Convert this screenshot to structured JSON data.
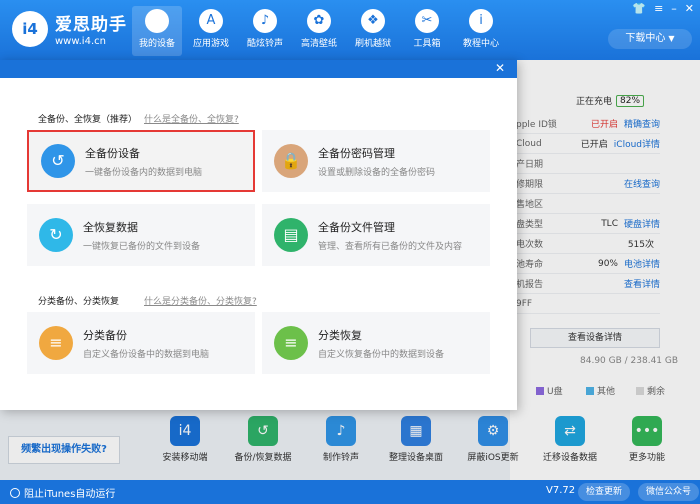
{
  "app": {
    "name": "爱思助手",
    "url": "www.i4.cn",
    "logo_text": "i4"
  },
  "nav": [
    {
      "label": "我的设备",
      "icon": "apple-icon",
      "glyph": "",
      "active": true
    },
    {
      "label": "应用游戏",
      "icon": "app-store-icon",
      "glyph": "A"
    },
    {
      "label": "酷炫铃声",
      "icon": "bell-icon",
      "glyph": "♪"
    },
    {
      "label": "高清壁纸",
      "icon": "flower-icon",
      "glyph": "✿"
    },
    {
      "label": "刷机越狱",
      "icon": "box-icon",
      "glyph": "❖"
    },
    {
      "label": "工具箱",
      "icon": "tools-icon",
      "glyph": "✂"
    },
    {
      "label": "教程中心",
      "icon": "info-icon",
      "glyph": "i"
    }
  ],
  "download_center": "下载中心",
  "device_info": {
    "charging": "正在充电",
    "battery": "82%",
    "rows": [
      {
        "label": "pple ID锁",
        "value": "已开启",
        "link": "精确查询"
      },
      {
        "label": "Cloud",
        "value": "已开启",
        "link": "iCloud详情"
      },
      {
        "label": "产日期",
        "value": "",
        "link": ""
      },
      {
        "label": "修期限",
        "value": "",
        "link": "在线查询"
      },
      {
        "label": "售地区",
        "value": "",
        "link": ""
      },
      {
        "label": "盘类型",
        "value": "TLC",
        "link": "硬盘详情"
      },
      {
        "label": "电次数",
        "value": "515次",
        "link": ""
      },
      {
        "label": "池寿命",
        "value": "90%",
        "link": "电池详情"
      },
      {
        "label": "机报告",
        "value": "",
        "link": "查看详情"
      },
      {
        "label": "9FF",
        "value": "",
        "link": ""
      }
    ],
    "detail_button": "查看设备详情",
    "storage": "84.90 GB / 238.41 GB",
    "legend": [
      {
        "label": "U盘",
        "color": "#8e6be0"
      },
      {
        "label": "其他",
        "color": "#4fb3e8"
      },
      {
        "label": "剩余",
        "color": "#d9d9d9"
      }
    ]
  },
  "tools": [
    {
      "label": "安装移动端",
      "color": "#1a72d9",
      "glyph": "i4"
    },
    {
      "label": "备份/恢复数据",
      "color": "#2fb36b",
      "glyph": "↺"
    },
    {
      "label": "制作铃声",
      "color": "#2f95e8",
      "glyph": "♪"
    },
    {
      "label": "整理设备桌面",
      "color": "#2f7fe0",
      "glyph": "▦"
    },
    {
      "label": "屏蔽iOS更新",
      "color": "#2f8fe8",
      "glyph": "⚙"
    },
    {
      "label": "迁移设备数据",
      "color": "#1fa7e0",
      "glyph": "⇄"
    },
    {
      "label": "更多功能",
      "color": "#35b85a",
      "glyph": "•••"
    }
  ],
  "fail_text": "频繁出现操作失败?",
  "status": {
    "itunes": "阻止iTunes自动运行",
    "version": "V7.72",
    "update_btn": "检查更新",
    "wechat_btn": "微信公众号"
  },
  "modal": {
    "section1_title": "全备份、全恢复（推荐）",
    "section1_link": "什么是全备份、全恢复?",
    "section2_title": "分类备份、分类恢复",
    "section2_link": "什么是分类备份、分类恢复?",
    "cards": [
      {
        "name": "全备份设备",
        "desc": "一键备份设备内的数据到电脑",
        "color": "#2f95e8",
        "glyph": "↺"
      },
      {
        "name": "全备份密码管理",
        "desc": "设置或删除设备的全备份密码",
        "color": "#d9a57a",
        "glyph": "🔒"
      },
      {
        "name": "全恢复数据",
        "desc": "一键恢复已备份的文件到设备",
        "color": "#2fb8e8",
        "glyph": "↻"
      },
      {
        "name": "全备份文件管理",
        "desc": "管理、查看所有已备份的文件及内容",
        "color": "#2fb36b",
        "glyph": "▤"
      },
      {
        "name": "分类备份",
        "desc": "自定义备份设备中的数据到电脑",
        "color": "#f0a840",
        "glyph": "≡"
      },
      {
        "name": "分类恢复",
        "desc": "自定义恢复备份中的数据到设备",
        "color": "#6cc04a",
        "glyph": "≡"
      }
    ]
  }
}
